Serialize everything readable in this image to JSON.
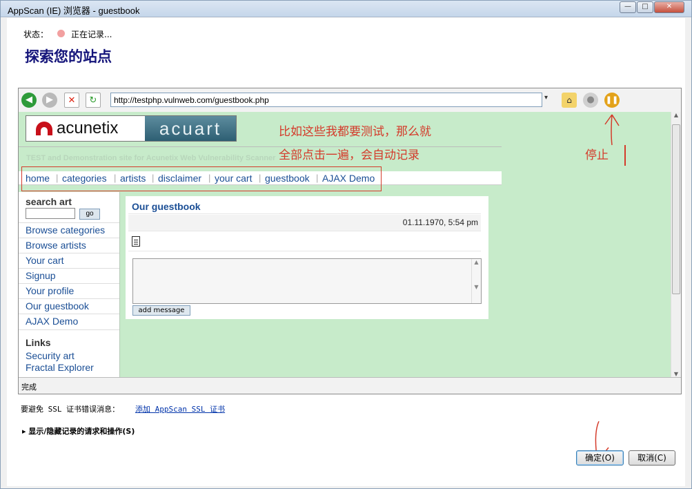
{
  "window": {
    "title": "AppScan (IE) 浏览器 - guestbook",
    "min": "—",
    "max": "□",
    "close": "✕"
  },
  "status": {
    "label": "状态：",
    "value": "正在记录..."
  },
  "heading": "探索您的站点",
  "browser": {
    "url": "http://testphp.vulnweb.com/guestbook.php",
    "status_text": "完成",
    "toolbar_icons": [
      "back-icon",
      "forward-icon",
      "stop-icon",
      "refresh-icon",
      "home-icon",
      "record-icon",
      "pause-icon"
    ],
    "site": {
      "logo_left": "acunetix",
      "logo_right": "acuart",
      "tagline": "TEST and Demonstration site for Acunetix Web Vulnerability Scanner",
      "nav": [
        "home",
        "categories",
        "artists",
        "disclaimer",
        "your cart",
        "guestbook",
        "AJAX Demo"
      ],
      "search_title": "search art",
      "search_go": "go",
      "side_links": [
        "Browse categories",
        "Browse artists",
        "Your cart",
        "Signup",
        "Your profile",
        "Our guestbook",
        "AJAX Demo"
      ],
      "links_title": "Links",
      "external_links": [
        "Security art",
        "Fractal Explorer"
      ],
      "guestbook_title": "Our guestbook",
      "entry_date": "01.11.1970, 5:54 pm",
      "add_message": "add message"
    }
  },
  "annotations": {
    "line1": "比如这些我都要测试，那么就",
    "line2": "全部点击一遍，会自动记录",
    "stop": "停止"
  },
  "ssl": {
    "label": "要避免 SSL 证书错误消息：",
    "link": "添加 AppScan SSL 证书"
  },
  "toggle": "显示/隐藏记录的请求和操作(S)",
  "buttons": {
    "ok": "确定(O)",
    "cancel": "取消(C)"
  },
  "colors": {
    "heading": "#14147a",
    "page_bg": "#c7ebca",
    "annotation": "#d43a2a",
    "link": "#1a4e95"
  }
}
